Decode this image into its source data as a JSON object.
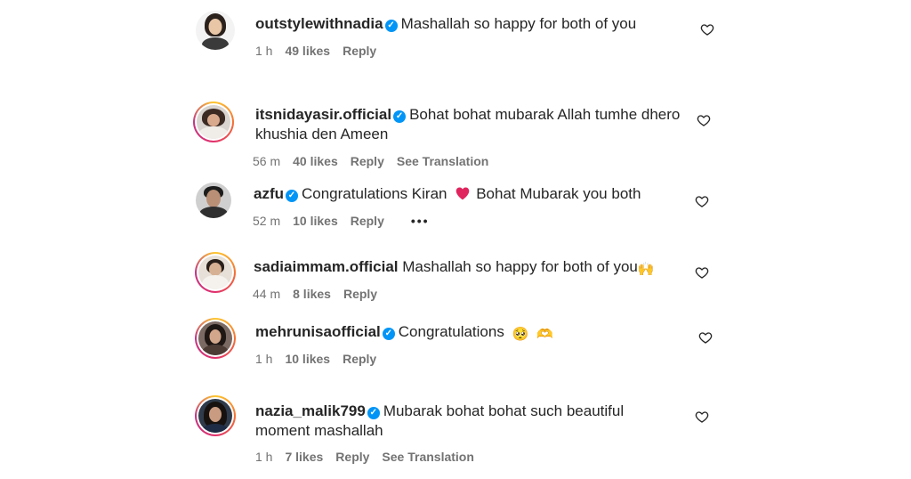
{
  "comments": [
    {
      "username": "outstylewithnadia",
      "verified": true,
      "text": "Mashallah so happy for both of you",
      "time": "1 h",
      "likes": "49 likes",
      "reply": "Reply"
    },
    {
      "username": "itsnidayasir.official",
      "verified": true,
      "text_line1": "Bohat bohat mubarak Allah tumhe dhero",
      "text_line2": "khushia den Ameen",
      "time": "56 m",
      "likes": "40 likes",
      "reply": "Reply",
      "translation": "See Translation"
    },
    {
      "username": "azfu",
      "verified": true,
      "text_a": "Congratulations Kiran",
      "text_b": "Bohat Mubarak you both",
      "time": "52 m",
      "likes": "10 likes",
      "reply": "Reply",
      "more": "•••"
    },
    {
      "username": "sadiaimmam.official",
      "verified": false,
      "text": "Mashallah so happy for both of you",
      "time": "44 m",
      "likes": "8 likes",
      "reply": "Reply"
    },
    {
      "username": "mehrunisaofficial",
      "verified": true,
      "text": "Congratulations",
      "time": "1 h",
      "likes": "10 likes",
      "reply": "Reply"
    },
    {
      "username": "nazia_malik799",
      "verified": true,
      "text_line1": "Mubarak bohat bohat such beautiful",
      "text_line2": "moment mashallah",
      "time": "1 h",
      "likes": "7 likes",
      "reply": "Reply",
      "translation": "See Translation"
    }
  ],
  "icons": {
    "verified": "verified-badge-icon",
    "like": "heart-outline-icon",
    "more": "more-options-icon"
  },
  "colors": {
    "verified_blue": "#0095f6",
    "meta_gray": "#737373",
    "text": "#262626",
    "heart_red": "#e0245e"
  }
}
